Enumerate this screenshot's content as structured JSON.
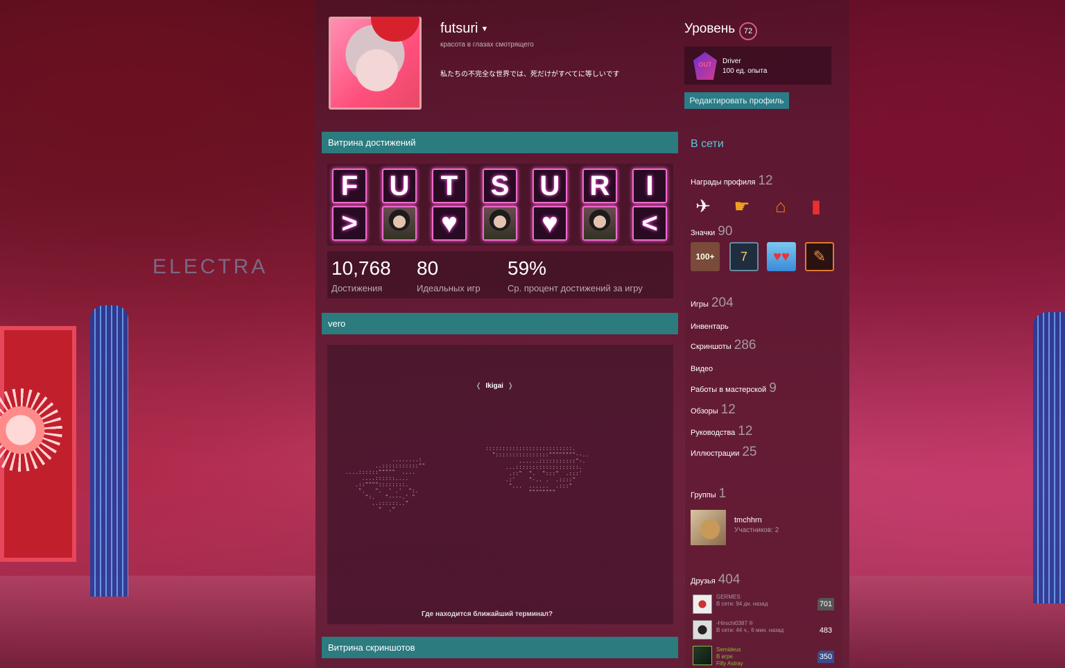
{
  "profile": {
    "username": "futsuri",
    "real_name": "красота в глазах смотрящего",
    "summary": "私たちの不完全な世界では、死だけがすべてに等しいです"
  },
  "level": {
    "label": "Уровень",
    "value": "72"
  },
  "favorite_badge": {
    "icon_text": "OUT DRIVE",
    "name": "Driver",
    "xp": "100 ед. опыта"
  },
  "edit_button": "Редактировать профиль",
  "achievement_showcase": {
    "title": "Витрина достижений",
    "row1": [
      "F",
      "U",
      "T",
      "S",
      "U",
      "R",
      "I"
    ],
    "row2": [
      ">",
      "img",
      "♥",
      "img",
      "♥",
      "img",
      "<"
    ],
    "stats": [
      {
        "value": "10,768",
        "label": "Достижения"
      },
      {
        "value": "80",
        "label": "Идеальных игр"
      },
      {
        "value": "59%",
        "label": "Ср. процент достижений за игру"
      }
    ]
  },
  "custom_showcase": {
    "title": "vero",
    "nav_prev": "❬",
    "nav_title": "Ikigai",
    "nav_next": "❭",
    "caption": "Где находится ближайший терминал?"
  },
  "screenshot_showcase": {
    "title": "Витрина скриншотов"
  },
  "sidebar": {
    "online": "В сети",
    "awards_label": "Награды профиля",
    "awards_count": "12",
    "badges_label": "Значки",
    "badges_count": "90",
    "badge_100": "100+",
    "badge_7": "7",
    "games_label": "Игры",
    "games_count": "204",
    "inventory_label": "Инвентарь",
    "screenshots_label": "Скриншоты",
    "screenshots_count": "286",
    "videos_label": "Видео",
    "workshop_label": "Работы в мастерской",
    "workshop_count": "9",
    "reviews_label": "Обзоры",
    "reviews_count": "12",
    "guides_label": "Руководства",
    "guides_count": "12",
    "artwork_label": "Иллюстрации",
    "artwork_count": "25",
    "groups_label": "Группы",
    "groups_count": "1",
    "group": {
      "name": "tmchhrn",
      "members": "Участников: 2"
    },
    "friends_label": "Друзья",
    "friends_count": "404",
    "friends": [
      {
        "name": "GERMES",
        "status": "В сети: 94 дн. назад",
        "level": "701",
        "color": "#a99aa2"
      },
      {
        "name": "-Hirschi0387 ®",
        "status": "В сети: 44 ч., 6 мин. назад",
        "level": "483",
        "color": "#a99aa2"
      },
      {
        "name": "Semideus",
        "status": "В игре",
        "status2": "Filly Astray",
        "level": "350",
        "color": "#90ba3c"
      }
    ]
  },
  "colors": {
    "accent_header": "#2b7b7f",
    "online": "#57cbde",
    "neon": "#f06ad0"
  },
  "background_text": "ELECTRA"
}
